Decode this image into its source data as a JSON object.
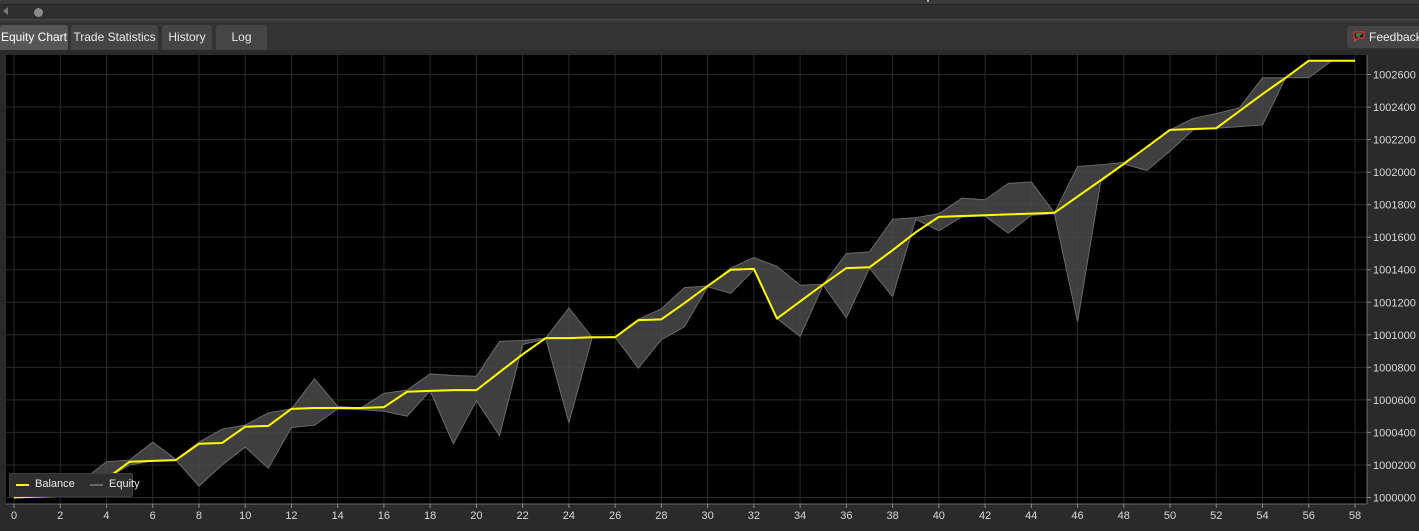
{
  "tabs": [
    {
      "label": "Equity Chart",
      "active": true
    },
    {
      "label": "Trade Statistics",
      "active": false
    },
    {
      "label": "History",
      "active": false
    },
    {
      "label": "Log",
      "active": false
    }
  ],
  "feedback_label": "Feedback",
  "colors": {
    "background": "#000000",
    "grid": "#2a2a2a",
    "balance": "#ffff00",
    "equity_fill": "#4a4a4a",
    "equity_line": "#6a6a6a"
  },
  "chart_data": {
    "type": "line",
    "grid": true,
    "legend_position": "bottom-left",
    "xlim": [
      0,
      58
    ],
    "ylim": [
      999960,
      1002720
    ],
    "x_ticks": [
      "0",
      "2",
      "4",
      "6",
      "8",
      "10",
      "12",
      "14",
      "16",
      "18",
      "20",
      "22",
      "24",
      "26",
      "28",
      "30",
      "32",
      "34",
      "36",
      "38",
      "40",
      "42",
      "44",
      "46",
      "48",
      "50",
      "52",
      "54",
      "56",
      "58"
    ],
    "y_ticks": [
      "1000000",
      "1000200",
      "1000400",
      "1000600",
      "1000800",
      "1001000",
      "1001200",
      "1001400",
      "1001600",
      "1001800",
      "1002000",
      "1002200",
      "1002400",
      "1002600"
    ],
    "series": [
      {
        "name": "Balance",
        "x": [
          0,
          1,
          2,
          3,
          4,
          5,
          6,
          7,
          8,
          9,
          10,
          11,
          12,
          13,
          14,
          15,
          16,
          17,
          18,
          19,
          20,
          21,
          22,
          23,
          24,
          25,
          26,
          27,
          28,
          29,
          30,
          31,
          32,
          33,
          34,
          35,
          36,
          37,
          38,
          39,
          40,
          41,
          42,
          43,
          44,
          45,
          46,
          47,
          48,
          49,
          50,
          51,
          52,
          53,
          54,
          55,
          56,
          57,
          58
        ],
        "values": [
          1000000,
          1000005,
          1000010,
          1000110,
          1000115,
          1000220,
          1000225,
          1000230,
          1000330,
          1000335,
          1000435,
          1000440,
          1000545,
          1000550,
          1000550,
          1000550,
          1000555,
          1000650,
          1000655,
          1000660,
          1000660,
          1000770,
          1000880,
          1000980,
          1000980,
          1000985,
          1000985,
          1001090,
          1001095,
          1001195,
          1001300,
          1001400,
          1001405,
          1001100,
          1001205,
          1001310,
          1001410,
          1001415,
          1001520,
          1001630,
          1001725,
          1001730,
          1001735,
          1001740,
          1001745,
          1001750,
          1001850,
          1001950,
          1002050,
          1002155,
          1002260,
          1002265,
          1002270,
          1002375,
          1002480,
          1002580,
          1002685,
          1002685,
          1002685
        ]
      },
      {
        "name": "Equity",
        "x": [
          0,
          1,
          2,
          3,
          4,
          5,
          6,
          7,
          8,
          9,
          10,
          11,
          12,
          13,
          14,
          15,
          16,
          17,
          18,
          19,
          20,
          21,
          22,
          23,
          24,
          25,
          26,
          27,
          28,
          29,
          30,
          31,
          32,
          33,
          34,
          35,
          36,
          37,
          38,
          39,
          40,
          41,
          42,
          43,
          44,
          45,
          46,
          47,
          48,
          49,
          50,
          51,
          52,
          53,
          54,
          55,
          56,
          57,
          58
        ],
        "upper": [
          1000000,
          1000005,
          1000010,
          1000110,
          1000220,
          1000230,
          1000340,
          1000235,
          1000340,
          1000420,
          1000445,
          1000520,
          1000545,
          1000730,
          1000560,
          1000550,
          1000640,
          1000660,
          1000760,
          1000750,
          1000745,
          1000960,
          1000965,
          1000980,
          1001165,
          1000985,
          1000990,
          1001095,
          1001160,
          1001290,
          1001300,
          1001410,
          1001475,
          1001420,
          1001305,
          1001310,
          1001500,
          1001510,
          1001710,
          1001720,
          1001745,
          1001840,
          1001830,
          1001930,
          1001940,
          1001750,
          1002035,
          1002045,
          1002060,
          1002155,
          1002260,
          1002330,
          1002360,
          1002395,
          1002580,
          1002580,
          1002685,
          1002685,
          1002685
        ]
      },
      {
        "name": "",
        "x": [
          0,
          1,
          2,
          3,
          4,
          5,
          6,
          7,
          8,
          9,
          10,
          11,
          12,
          13,
          14,
          15,
          16,
          17,
          18,
          19,
          20,
          21,
          22,
          23,
          24,
          25,
          26,
          27,
          28,
          29,
          30,
          31,
          32,
          33,
          34,
          35,
          36,
          37,
          38,
          39,
          40,
          41,
          42,
          43,
          44,
          45,
          46,
          47,
          48,
          49,
          50,
          51,
          52,
          53,
          54,
          55,
          56,
          57,
          58
        ],
        "lower": [
          1000000,
          1000005,
          1000010,
          1000060,
          1000115,
          1000200,
          1000225,
          1000230,
          1000070,
          1000200,
          1000310,
          1000180,
          1000430,
          1000445,
          1000545,
          1000540,
          1000530,
          1000500,
          1000655,
          1000330,
          1000595,
          1000380,
          1000940,
          1000975,
          1000460,
          1000980,
          1000985,
          1000795,
          1000970,
          1001050,
          1001295,
          1001255,
          1001400,
          1001100,
          1000990,
          1001305,
          1001105,
          1001410,
          1001235,
          1001710,
          1001640,
          1001725,
          1001730,
          1001625,
          1001735,
          1001745,
          1001080,
          1001940,
          1002050,
          1002010,
          1002130,
          1002260,
          1002270,
          1002280,
          1002290,
          1002580,
          1002580,
          1002685,
          1002685
        ]
      }
    ]
  },
  "legend": {
    "balance_label": "Balance",
    "equity_label": "Equity"
  }
}
